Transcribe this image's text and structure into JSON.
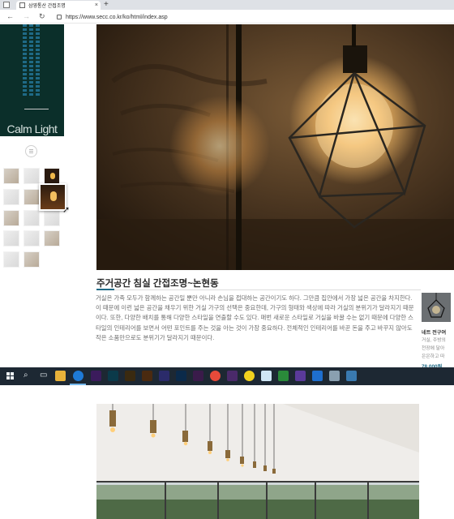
{
  "browser": {
    "tab_title": "삼영통산 간접조명",
    "tab_close": "×",
    "new_tab": "+",
    "back": "←",
    "forward": "→",
    "reload": "↻",
    "url": "https://www.secc.co.kr/ko/html/index.asp"
  },
  "sidebar": {
    "brand_title": "Calm Light"
  },
  "post": {
    "title": "주거공간 침실 간접조명~논현동",
    "body": "거실은 가족 모두가 함께하는 공간일 뿐만 아니라 손님을 접대하는 공간이기도 하다. 그만큼 집안에서 가장 넓은 공간을 차지한다. 이 때문에 이런 넓은 공간을 채우기 위한 거실 가구의 선택은 중요한데, 가구의 형태와 색상에 따라 거실의 분위기가 달라지기 때문이다. 또한, 다양한 배치를 통해 다양한 스타일을 연출할 수도 있다. 매번 새로운 스타일로 거실을 바꿀 수는 없기 때문에 다양한 스타일의 인테리어를 보면서 어떤 포인트를 주는 것을 아는 것이 가장 중요하다. 전체적인 인테리어를 바꾼 돈을 주고 바꾸지 않아도 작은 소품만으로도 분위기가 달라지기 때문이다."
  },
  "side_product": {
    "name": "네트 전구여",
    "desc_line1": "거실, 주방의",
    "desc_line2": "천장에 달아",
    "desc_line3": "은은하고 따",
    "price": "78,000원"
  },
  "taskbar": {
    "search_glyph": "⌕",
    "taskview_glyph": "▭"
  },
  "colors": {
    "accent": "#1f6a86",
    "banner_bg": "#0b2f2a",
    "taskbar_bg": "#1d2833"
  }
}
